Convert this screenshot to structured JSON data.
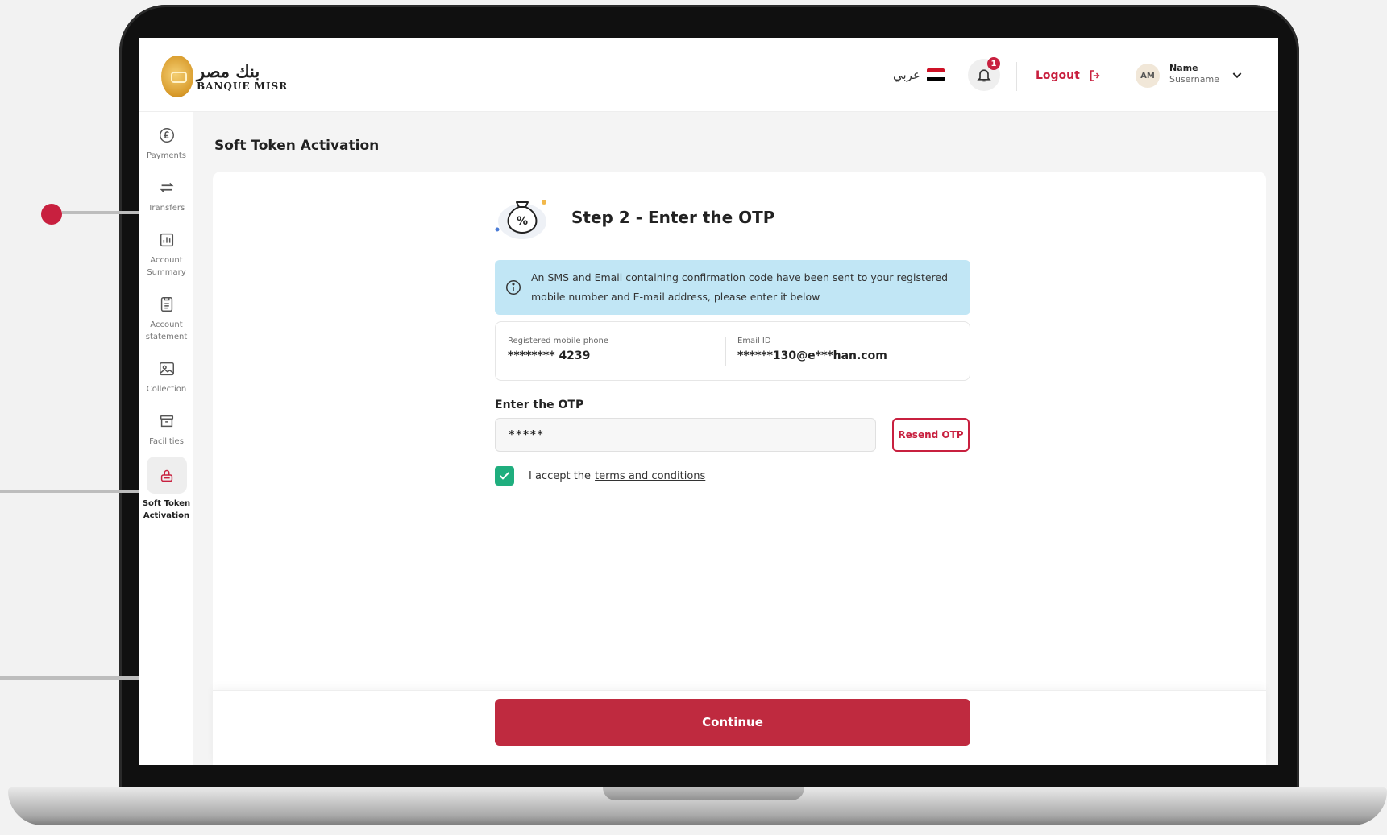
{
  "brand": {
    "name_ar": "بنك مصر",
    "name_en": "BANQUE MISR",
    "accent_color": "#c8203f",
    "gold_color": "#d89a2a"
  },
  "header": {
    "language_label": "عربي",
    "language_flag": "egypt-flag",
    "notification_count": "1",
    "logout_label": "Logout",
    "avatar_initials": "AM",
    "user_name": "Name",
    "user_username": "Susername"
  },
  "sidebar": {
    "items": [
      {
        "label": "Payments",
        "icon": "pound-coin-icon",
        "active": false
      },
      {
        "label": "Transfers",
        "icon": "transfer-arrows-icon",
        "active": false
      },
      {
        "label": "Account\nSummary",
        "icon": "bar-chart-icon",
        "active": false
      },
      {
        "label": "Account\nstatement",
        "icon": "document-list-icon",
        "active": false
      },
      {
        "label": "Collection",
        "icon": "collection-image-icon",
        "active": false
      },
      {
        "label": "Facilities",
        "icon": "archive-box-icon",
        "active": false
      },
      {
        "label": "Soft Token\nActivation",
        "icon": "token-lock-icon",
        "active": true
      }
    ]
  },
  "page": {
    "title": "Soft Token Activation"
  },
  "step": {
    "title": "Step 2 - Enter the OTP",
    "icon": "money-bag-percent-icon"
  },
  "info_banner": {
    "text": "An SMS and Email containing confirmation code have been sent to your registered mobile number and E-mail address, please enter it below",
    "bg_color": "#c1e6f5"
  },
  "details": {
    "mobile_label": "Registered mobile phone",
    "mobile_value": "******** 4239",
    "email_label": "Email ID",
    "email_value": "******130@e***han.com"
  },
  "otp": {
    "label": "Enter the OTP",
    "value": "*****",
    "resend_label": "Resend OTP"
  },
  "terms": {
    "checked": true,
    "prefix": "I accept the",
    "link_text": "terms and conditions",
    "checkbox_color": "#1fae7e"
  },
  "actions": {
    "continue_label": "Continue",
    "continue_color": "#bf2a3f"
  }
}
